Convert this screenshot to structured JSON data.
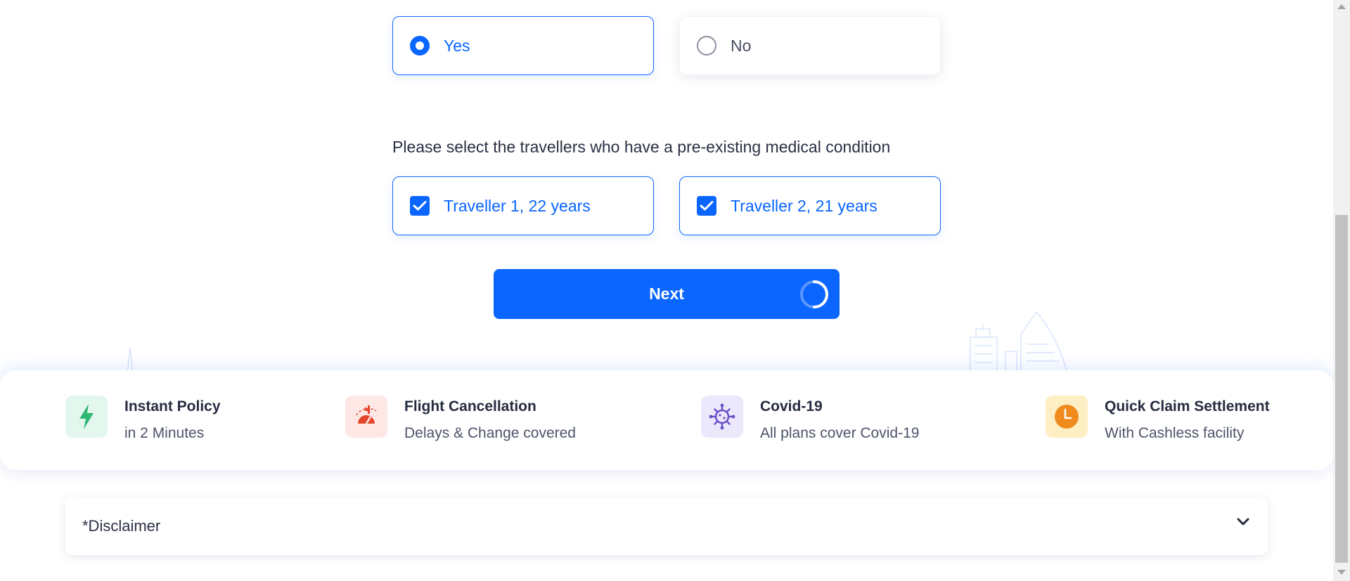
{
  "preexisting_question": {
    "options": [
      {
        "label": "Yes",
        "selected": true
      },
      {
        "label": "No",
        "selected": false
      }
    ]
  },
  "travellers_section": {
    "question": "Please select the travellers who have a pre-existing medical condition",
    "travellers": [
      {
        "label": "Traveller 1, 22 years",
        "checked": true
      },
      {
        "label": "Traveller 2, 21 years",
        "checked": true
      }
    ]
  },
  "next_button": {
    "label": "Next",
    "loading": true
  },
  "features": [
    {
      "icon": "lightning-icon",
      "title": "Instant Policy",
      "subtitle": "in 2 Minutes",
      "icon_bg": "#e3f7ee",
      "icon_color": "#2eb872"
    },
    {
      "icon": "flight-cancel-icon",
      "title": "Flight Cancellation",
      "subtitle": "Delays & Change covered",
      "icon_bg": "#fde8e6",
      "icon_color": "#e5472d"
    },
    {
      "icon": "virus-icon",
      "title": "Covid-19",
      "subtitle": "All plans cover Covid-19",
      "icon_bg": "#ece8fb",
      "icon_color": "#6a4fc8"
    },
    {
      "icon": "clock-icon",
      "title": "Quick Claim Settlement",
      "subtitle": "With Cashless facility",
      "icon_bg": "#fdeec4",
      "icon_color": "#f08a1c"
    }
  ],
  "disclaimer": {
    "label": "*Disclaimer",
    "icon": "chevron-down-icon"
  },
  "colors": {
    "primary": "#0a66ff",
    "text": "#2b3044"
  }
}
